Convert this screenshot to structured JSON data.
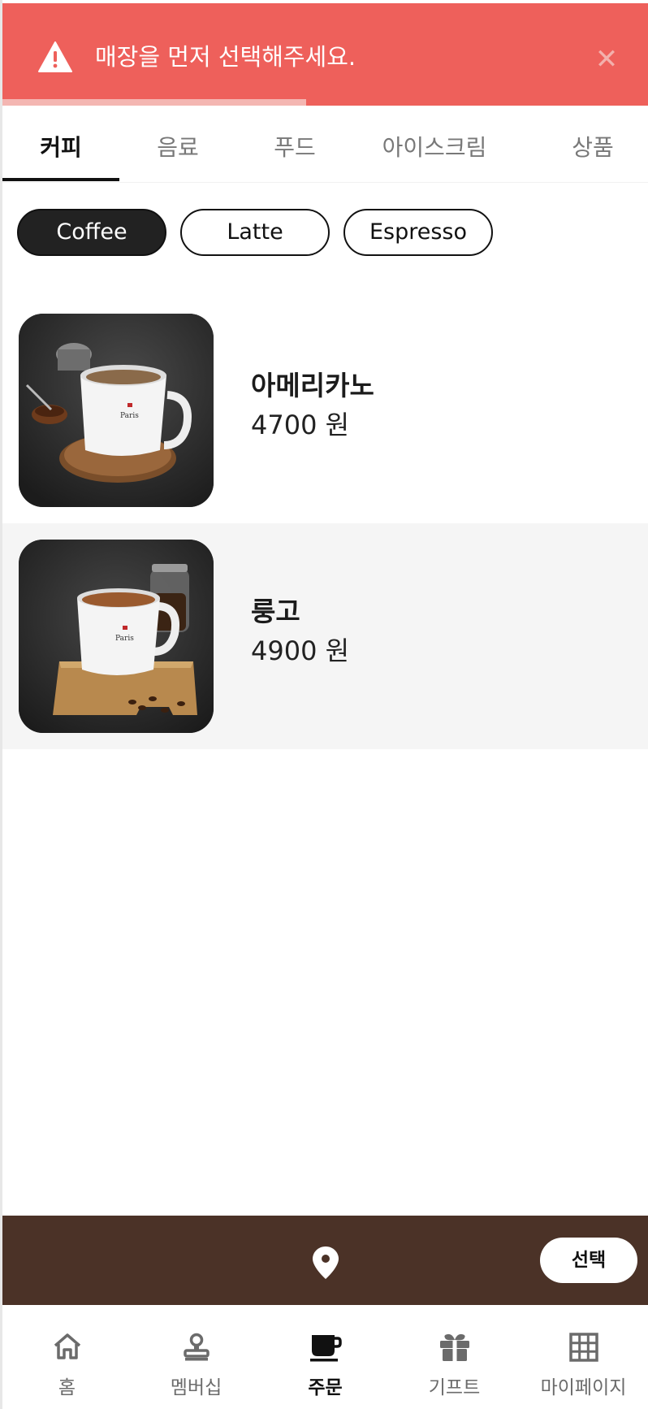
{
  "toast": {
    "message": "매장을 먼저 선택해주세요.",
    "icon": "warning-icon",
    "close_icon": "close-icon",
    "bg_color": "#ee605b",
    "progress": 0.47
  },
  "tabs": [
    {
      "label": "커피",
      "active": true
    },
    {
      "label": "음료",
      "active": false
    },
    {
      "label": "푸드",
      "active": false
    },
    {
      "label": "아이스크림",
      "active": false
    },
    {
      "label": "상품",
      "active": false
    }
  ],
  "chips": [
    {
      "label": "Coffee",
      "active": true
    },
    {
      "label": "Latte",
      "active": false
    },
    {
      "label": "Espresso",
      "active": false
    }
  ],
  "products": [
    {
      "name": "아메리카노",
      "price": "4700 원"
    },
    {
      "name": "룽고",
      "price": "4900 원"
    }
  ],
  "store_bar": {
    "pin_icon": "location-pin-icon",
    "select_label": "선택",
    "bg_color": "#4b3227"
  },
  "bottom_nav": [
    {
      "label": "홈",
      "icon": "home-icon",
      "active": false
    },
    {
      "label": "멤버십",
      "icon": "stamp-icon",
      "active": false
    },
    {
      "label": "주문",
      "icon": "coffee-cup-icon",
      "active": true
    },
    {
      "label": "기프트",
      "icon": "gift-icon",
      "active": false
    },
    {
      "label": "마이페이지",
      "icon": "grid-icon",
      "active": false
    }
  ]
}
